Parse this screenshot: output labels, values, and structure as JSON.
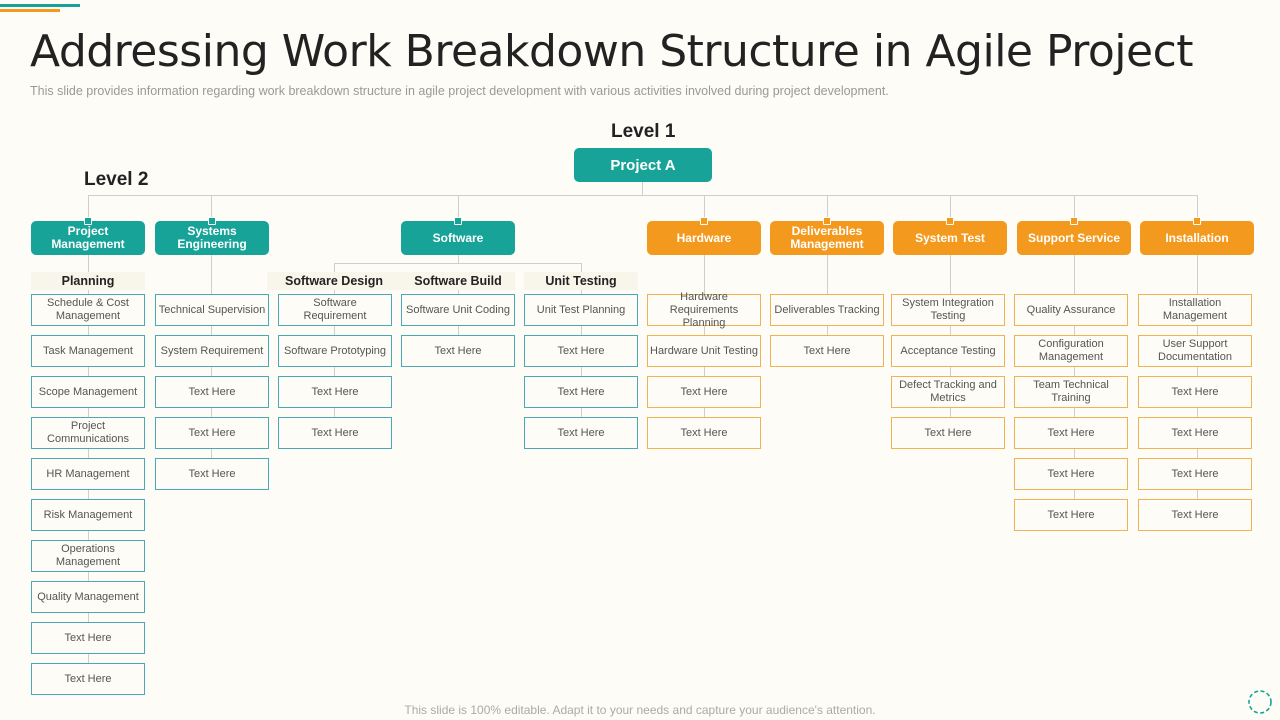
{
  "title": "Addressing Work Breakdown Structure in Agile Project",
  "subtitle": "This slide provides  information  regarding  work breakdown  structure in agile project development  with various  activities involved  during project  development.",
  "level1_label": "Level 1",
  "level2_label": "Level 2",
  "root_label": "Project A",
  "colors": {
    "teal": "#17a398",
    "orange": "#f39a1e"
  },
  "heads": {
    "pm": "Project Management",
    "se": "Systems Engineering",
    "sw": "Software",
    "hw": "Hardware",
    "dm": "Deliverables Management",
    "st": "System Test",
    "ss": "Support Service",
    "in": "Installation"
  },
  "subheads": {
    "planning": "Planning",
    "sw_design": "Software Design",
    "sw_build": "Software Build",
    "unit_testing": "Unit  Testing"
  },
  "columns": {
    "pm": [
      "Schedule & Cost Management",
      "Task Management",
      "Scope Management",
      "Project Communications",
      "HR Management",
      "Risk Management",
      "Operations Management",
      "Quality Management",
      "Text Here",
      "Text Here"
    ],
    "se": [
      "Technical Supervision",
      "System Requirement",
      "Text Here",
      "Text Here",
      "Text Here"
    ],
    "sd": [
      "Software Requirement",
      "Software Prototyping",
      "Text Here",
      "Text Here"
    ],
    "sb": [
      "Software Unit Coding",
      "Text Here"
    ],
    "ut": [
      "Unit Test Planning",
      "Text Here",
      "Text Here",
      "Text Here"
    ],
    "hw": [
      "Hardware Requirements Planning",
      "Hardware Unit Testing",
      "Text Here",
      "Text Here"
    ],
    "dm": [
      "Deliverables Tracking",
      "Text Here"
    ],
    "st": [
      "System Integration Testing",
      "Acceptance Testing",
      "Defect Tracking and Metrics",
      "Text Here"
    ],
    "ss": [
      "Quality Assurance",
      "Configuration Management",
      "Team Technical Training",
      "Text Here",
      "Text Here",
      "Text Here"
    ],
    "in": [
      "Installation Management",
      "User Support Documentation",
      "Text Here",
      "Text Here",
      "Text Here",
      "Text Here"
    ]
  },
  "footer": "This slide is 100% editable. Adapt it to your needs and capture your audience's attention."
}
